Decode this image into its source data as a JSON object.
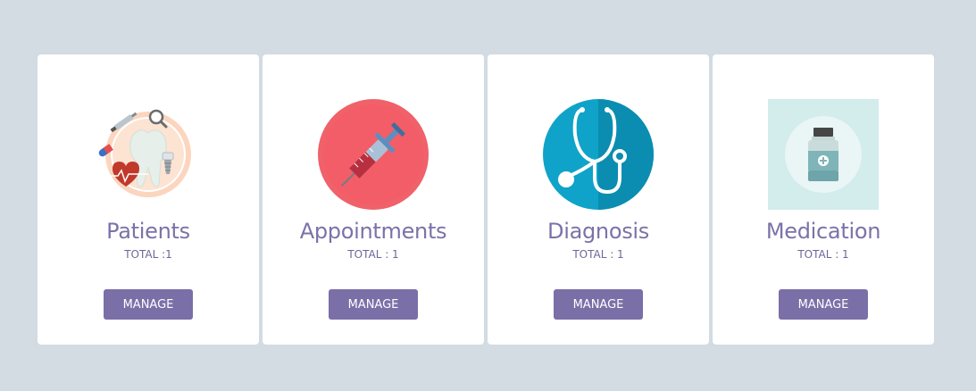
{
  "cards": [
    {
      "title": "Patients",
      "total": "TOTAL :1",
      "button": "MANAGE",
      "icon": "tooth-dental-icon"
    },
    {
      "title": "Appointments",
      "total": "TOTAL : 1",
      "button": "MANAGE",
      "icon": "syringe-icon"
    },
    {
      "title": "Diagnosis",
      "total": "TOTAL : 1",
      "button": "MANAGE",
      "icon": "stethoscope-icon"
    },
    {
      "title": "Medication",
      "total": "TOTAL : 1",
      "button": "MANAGE",
      "icon": "medicine-bottle-icon"
    }
  ],
  "colors": {
    "background": "#d3dbe3",
    "card": "#ffffff",
    "accent": "#7b6fa8",
    "title": "#7b72a8"
  }
}
